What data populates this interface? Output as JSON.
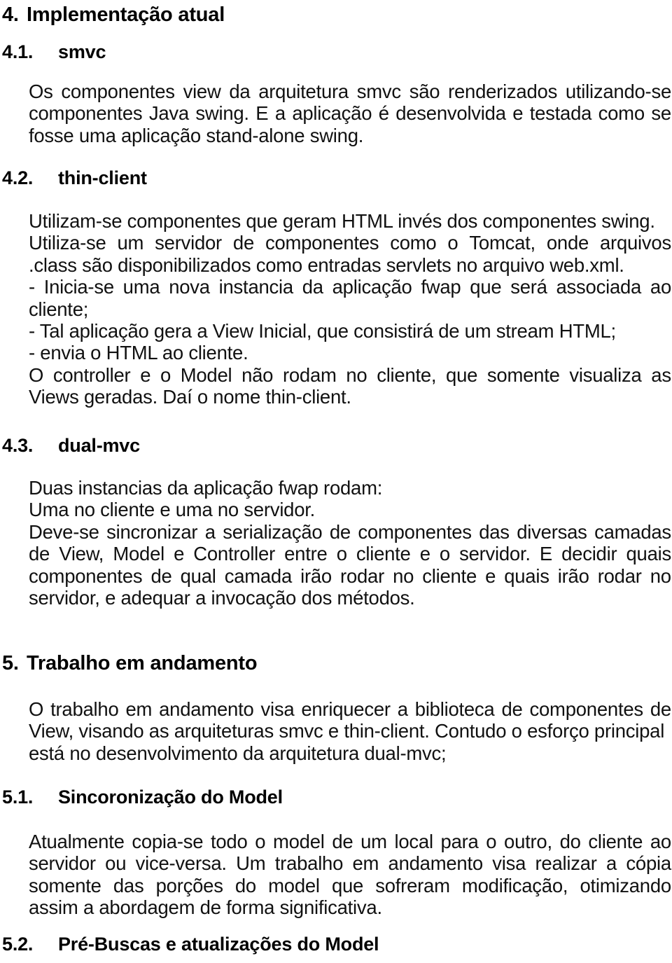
{
  "document": {
    "language": "pt-BR",
    "page_background": "#ffffff",
    "text_color": "#000000"
  },
  "sections": [
    {
      "id": "sec-4",
      "level": 1,
      "number": "4.",
      "title": "Implementação atual"
    },
    {
      "id": "sec-4-1",
      "level": 2,
      "number": "4.1.",
      "title": "smvc",
      "paragraph_lines": [
        "Os componentes view da arquitetura smvc são renderizados utilizando-se",
        "componentes Java swing. E a aplicação é desenvolvida e testada como se",
        "fosse uma aplicação stand-alone swing."
      ],
      "paragraph_text": "Os componentes view da arquitetura smvc são renderizados utilizando-se componentes Java swing. E a aplicação é desenvolvida e testada como se fosse uma aplicação stand-alone swing."
    },
    {
      "id": "sec-4-2",
      "level": 2,
      "number": "4.2.",
      "title": "thin-client",
      "paragraph_lines": [
        "Utilizam-se componentes que geram HTML invés dos componentes swing.",
        "Utiliza-se um servidor de componentes como o Tomcat, onde arquivos",
        ".class são disponibilizados como entradas servlets no arquivo web.xml.",
        "- Inicia-se uma nova instancia da aplicação fwap que será associada ao",
        "cliente;",
        "- Tal aplicação gera a View Inicial, que consistirá de um stream HTML;",
        "- envia o HTML ao cliente.",
        "O controller e o Model não rodam no cliente, que somente visualiza as",
        "Views geradas. Daí o nome thin-client."
      ],
      "paragraph_text": "Utilizam-se componentes que geram HTML invés dos componentes swing. Utiliza-se um servidor de componentes como o Tomcat, onde arquivos .class são disponibilizados como entradas servlets no arquivo web.xml. - Inicia-se uma nova instancia da aplicação fwap que será associada ao cliente; - Tal aplicação gera a View Inicial, que consistirá de um stream HTML; - envia o HTML ao cliente. O controller e o Model não rodam no cliente, que somente visualiza as Views geradas. Daí o nome thin-client."
    },
    {
      "id": "sec-4-3",
      "level": 2,
      "number": "4.3.",
      "title": "dual-mvc",
      "paragraph_lines": [
        "Duas instancias da aplicação fwap rodam:",
        "Uma no cliente e uma no servidor.",
        "Deve-se sincronizar a serialização de componentes das diversas camadas",
        "de View, Model e Controller entre o cliente e o servidor. E decidir quais",
        "componentes de qual camada irão rodar no cliente e quais irão rodar no",
        "servidor, e adequar a invocação dos métodos."
      ],
      "paragraph_text": "Duas instancias da aplicação fwap rodam: Uma no cliente e uma no servidor. Deve-se sincronizar a serialização de componentes das diversas camadas de View, Model e Controller entre o cliente e o servidor. E decidir quais componentes de qual camada irão rodar no cliente e quais irão rodar no servidor, e adequar a invocação dos métodos."
    },
    {
      "id": "sec-5",
      "level": 1,
      "number": "5.",
      "title": "Trabalho em andamento",
      "paragraph_lines": [
        "O trabalho em andamento visa enriquecer a biblioteca de componentes de",
        "View, visando as arquiteturas smvc e thin-client. Contudo o esforço principal",
        "está no desenvolvimento da arquitetura dual-mvc;"
      ],
      "paragraph_text": "O trabalho em andamento visa enriquecer a biblioteca de componentes de View, visando as arquiteturas smvc e thin-client. Contudo o esforço principal está no desenvolvimento da arquitetura dual-mvc;"
    },
    {
      "id": "sec-5-1",
      "level": 2,
      "number": "5.1.",
      "title": "Sincoronização do Model",
      "paragraph_lines": [
        "Atualmente copia-se todo o model de um local para o outro, do cliente ao",
        "servidor ou vice-versa. Um trabalho em andamento visa realizar a cópia",
        "somente das porções do model que sofreram modificação, otimizando",
        "assim a abordagem de forma significativa."
      ],
      "paragraph_text": "Atualmente copia-se todo o model de um local para o outro, do cliente ao servidor ou vice-versa. Um trabalho em andamento visa realizar a cópia somente das porções do model que sofreram modificação, otimizando assim a abordagem de forma significativa."
    },
    {
      "id": "sec-5-2",
      "level": 2,
      "number": "5.2.",
      "title": "Pré-Buscas e atualizações do Model"
    }
  ],
  "lines": {
    "s41_l1": "Os componentes view da arquitetura smvc são renderizados utilizando-se",
    "s41_l2": "componentes Java swing. E a aplicação é desenvolvida e testada como se",
    "s41_l3": "fosse uma aplicação stand-alone swing.",
    "s42_l1": "Utilizam-se componentes que geram HTML invés dos componentes swing.",
    "s42_l2": "Utiliza-se um servidor de componentes como o Tomcat, onde arquivos",
    "s42_l3": ".class são disponibilizados como entradas servlets no arquivo web.xml.",
    "s42_l4": "- Inicia-se uma nova instancia da aplicação fwap que será associada ao",
    "s42_l5": "cliente;",
    "s42_l6": "- Tal aplicação gera a View Inicial, que consistirá de um stream HTML;",
    "s42_l7": "- envia o HTML ao cliente.",
    "s42_l8": "O controller e o Model não rodam no cliente, que somente visualiza as",
    "s42_l9": "Views geradas. Daí o nome thin-client.",
    "s43_l1": "Duas instancias da aplicação fwap rodam:",
    "s43_l2": "Uma no cliente e uma no servidor.",
    "s43_l3": "Deve-se sincronizar a serialização de componentes das diversas camadas",
    "s43_l4": "de View, Model e Controller entre o cliente e o servidor. E decidir quais",
    "s43_l5": "componentes de qual camada irão rodar no cliente e quais irão rodar no",
    "s43_l6": "servidor, e adequar a invocação dos métodos.",
    "s5_l1": "O trabalho em andamento visa enriquecer a biblioteca de componentes de",
    "s5_l2": "View, visando as arquiteturas smvc e thin-client. Contudo o esforço principal",
    "s5_l3": "está no desenvolvimento da arquitetura dual-mvc;",
    "s51_l1": "Atualmente copia-se todo o model de um local para o outro, do cliente ao",
    "s51_l2": "servidor ou vice-versa. Um trabalho em andamento visa realizar a cópia",
    "s51_l3": "somente das porções do model que sofreram modificação, otimizando",
    "s51_l4": "assim a abordagem de forma significativa."
  }
}
